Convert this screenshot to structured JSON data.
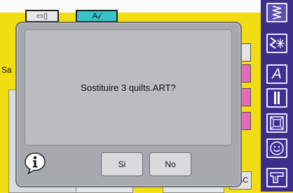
{
  "dialog": {
    "message": "Sostituire 3 quilts.ART?",
    "yes_label": "Si",
    "no_label": "No"
  },
  "background": {
    "tab_stitch_glyph": "▭▯",
    "tab_embroidery_glyph": "Aᵥ⁄",
    "left_label": "Sa",
    "esc_label": "ESC"
  },
  "toolbar": {
    "icons": [
      "zigzag-stitch-icon",
      "decorative-stitch-icon",
      "alphabet-icon",
      "buttonhole-icon",
      "quilt-icon",
      "smiley-icon",
      "sewing-machine-icon"
    ],
    "letter_a": "A"
  },
  "colors": {
    "toolbar_bg": "#3c2e8a",
    "dialog_bg": "#a6aaaf",
    "app_bg": "#f1dd12",
    "accent_cyan": "#38c3c8"
  }
}
